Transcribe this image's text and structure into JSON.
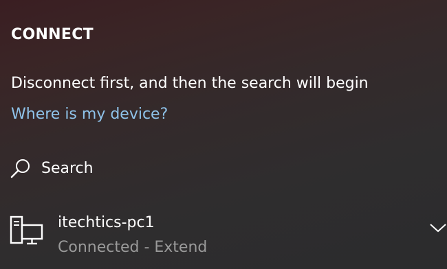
{
  "panel": {
    "title": "CONNECT",
    "status_message": "Disconnect first, and then the search will begin",
    "help_link": "Where is my device?",
    "search_label": "Search",
    "devices": [
      {
        "name": "itechtics-pc1",
        "status": "Connected - Extend",
        "icon": "computer-icon"
      }
    ]
  },
  "colors": {
    "link": "#8fc3ea",
    "secondary_text": "#9a9a9a",
    "text": "#ffffff"
  }
}
